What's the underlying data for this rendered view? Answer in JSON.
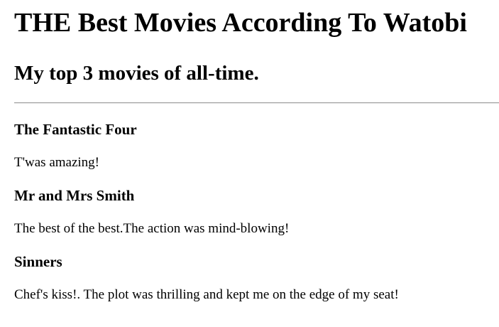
{
  "header": {
    "title": "THE Best Movies According To Watobi",
    "subtitle": "My top 3 movies of all-time."
  },
  "movies": [
    {
      "title": "The Fantastic Four",
      "review": "T'was amazing!"
    },
    {
      "title": "Mr and Mrs Smith",
      "review": "The best of the best.The action was mind-blowing!"
    },
    {
      "title": "Sinners",
      "review": "Chef's kiss!. The plot was thrilling and kept me on the edge of my seat!"
    }
  ]
}
